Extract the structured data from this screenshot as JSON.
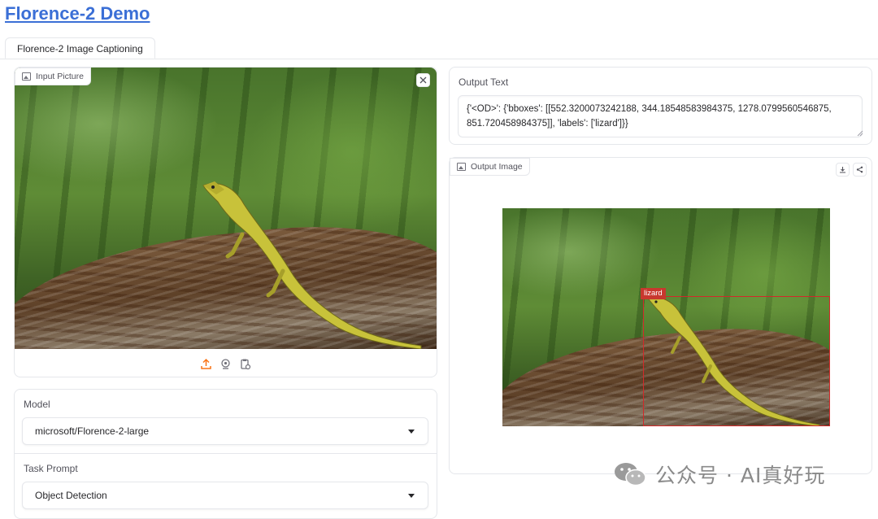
{
  "app": {
    "title": "Florence-2 Demo"
  },
  "tabs": [
    {
      "label": "Florence-2 Image Captioning"
    }
  ],
  "input_panel": {
    "label": "Input Picture"
  },
  "model": {
    "label": "Model",
    "value": "microsoft/Florence-2-large"
  },
  "task_prompt": {
    "label": "Task Prompt",
    "value": "Object Detection"
  },
  "output_text": {
    "label": "Output Text",
    "value": "{'<OD>': {'bboxes': [[552.3200073242188, 344.18548583984375, 1278.0799560546875, 851.720458984375]], 'labels': ['lizard']}}"
  },
  "output_image": {
    "label": "Output Image",
    "detections": [
      {
        "label": "lizard"
      }
    ]
  },
  "watermark": {
    "text": "公众号 · AI真好玩"
  },
  "colors": {
    "title_link": "#3b6fd6",
    "bbox": "#d12a2a",
    "upload_accent": "#f97316"
  }
}
